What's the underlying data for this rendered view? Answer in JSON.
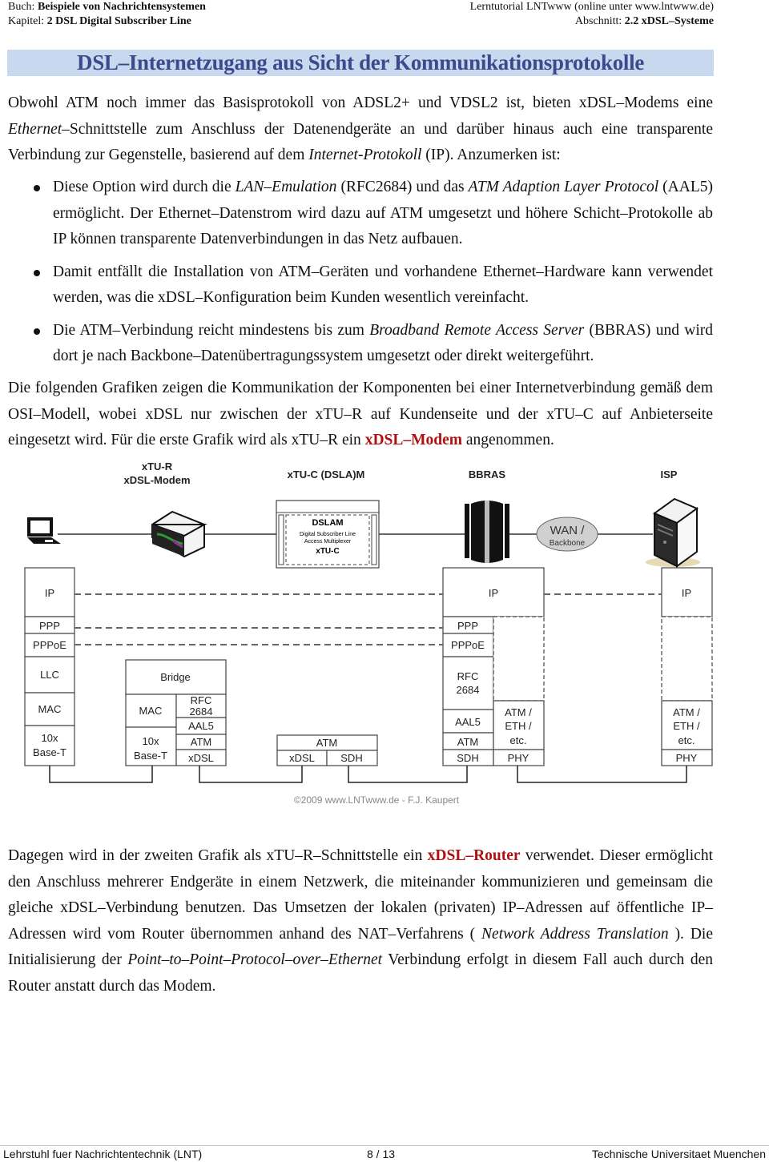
{
  "header": {
    "book_label": "Buch:",
    "book_title": "Beispiele von Nachrichtensystemen",
    "chapter_label": "Kapitel:",
    "chapter_title": "2 DSL Digital Subscriber Line",
    "site_label": "Lerntutorial LNTwww (online unter www.lntwww.de)",
    "section_label": "Abschnitt:",
    "section_title": "2.2 xDSL–Systeme"
  },
  "page_title": "DSL–Internetzugang aus Sicht der Kommunikationsprotokolle",
  "intro": {
    "t1": "Obwohl ATM noch immer das Basisprotokoll von ADSL2+ und VDSL2 ist, bieten xDSL–Modems eine ",
    "i1": "Ethernet",
    "t2": "–Schnittstelle zum Anschluss der Datenendgeräte an und darüber hinaus auch eine transparente Verbindung zur Gegenstelle, basierend auf dem ",
    "i2": "Internet-Protokoll",
    "t3": " (IP). Anzumerken ist:"
  },
  "bullets": [
    {
      "t1": "Diese Option wird durch die ",
      "i1": "LAN–Emulation",
      "t2": " (RFC2684) und das ",
      "i2": "ATM Adaption Layer Protocol",
      "t3": " (AAL5) ermöglicht. Der Ethernet–Datenstrom wird dazu auf ATM umgesetzt und höhere Schicht–Protokolle ab IP können transparente Datenverbindungen in das Netz aufbauen."
    },
    {
      "t1": "Damit entfällt die Installation von ATM–Geräten und vorhandene Ethernet–Hardware kann verwendet werden, was die xDSL–Konfiguration beim Kunden wesentlich vereinfacht."
    },
    {
      "t1": "Die ATM–Verbindung reicht mindestens bis zum ",
      "i1": "Broadband Remote Access Server",
      "t2": " (BBRAS) und wird dort je nach Backbone–Datenübertragungssystem umgesetzt oder direkt weitergeführt."
    }
  ],
  "para2": {
    "t1": "Die folgenden Grafiken zeigen die Kommunikation der Komponenten bei einer Internetverbindung gemäß dem OSI–Modell, wobei xDSL nur zwischen der xTU–R auf Kundenseite und der xTU–C auf Anbieterseite eingesetzt wird. Für die erste Grafik wird als xTU–R ein ",
    "highlight": "xDSL–Modem",
    "t2": " angenommen."
  },
  "figure": {
    "devices": {
      "xtur_line1": "xTU-R",
      "xtur_line2": "xDSL-Modem",
      "xtuc": "xTU-C (DSLA)M",
      "bbras": "BBRAS",
      "isp": "ISP",
      "dslam_title": "DSLAM",
      "dslam_sub1": "Digital Subscriber Line",
      "dslam_sub2": "Access Multiplexer",
      "dslam_xtuc": "xTU-C",
      "wan_line1": "WAN /",
      "wan_line2": "Backbone"
    },
    "stack_pc": [
      "IP",
      "PPP",
      "PPPoE",
      "LLC",
      "MAC",
      "10x",
      "Base-T"
    ],
    "stack_modem": {
      "bridge": "Bridge",
      "mac": "MAC",
      "base1": "10x",
      "base2": "Base-T",
      "rfc1": "RFC",
      "rfc2": "2684",
      "aal5": "AAL5",
      "atm": "ATM",
      "xdsl": "xDSL"
    },
    "stack_dslam": {
      "atm": "ATM",
      "xdsl": "xDSL",
      "sdh": "SDH"
    },
    "stack_bbras": {
      "ip": "IP",
      "ppp": "PPP",
      "pppoe": "PPPoE",
      "rfc1": "RFC",
      "rfc2": "2684",
      "aal5": "AAL5",
      "atm": "ATM",
      "sdh": "SDH",
      "eth1": "ATM /",
      "eth2": "ETH /",
      "eth3": "etc.",
      "phy": "PHY"
    },
    "stack_isp": {
      "ip": "IP",
      "eth1": "ATM /",
      "eth2": "ETH /",
      "eth3": "etc.",
      "phy": "PHY"
    },
    "copyright": "©2009 www.LNTwww.de - F.J. Kaupert"
  },
  "para3": {
    "t1": "Dagegen wird in der zweiten Grafik als xTU–R–Schnittstelle ein ",
    "highlight": "xDSL–Router",
    "t2": " verwendet. Dieser ermöglicht den Anschluss mehrerer Endgeräte in einem Netzwerk, die miteinander kommunizieren und gemeinsam die gleiche xDSL–Verbindung benutzen. Das Umsetzen der lokalen (privaten) IP–Adressen auf öffentliche IP–Adressen wird vom Router übernommen anhand des NAT–Verfahrens ( ",
    "i1": "Network Address Translation",
    "t3": " ). Die Initialisierung der ",
    "i2": "Point–to–Point–Protocol–over–Ethernet",
    "t4": " Verbindung erfolgt in diesem Fall auch durch den Router anstatt durch das Modem."
  },
  "footer": {
    "left": "Lehrstuhl fuer Nachrichtentechnik (LNT)",
    "page": "8 / 13",
    "right": "Technische Universitaet Muenchen"
  },
  "colors": {
    "title_bg": "#c8d8ee",
    "title_text": "#3a4a8c",
    "highlight_red": "#b01010"
  }
}
